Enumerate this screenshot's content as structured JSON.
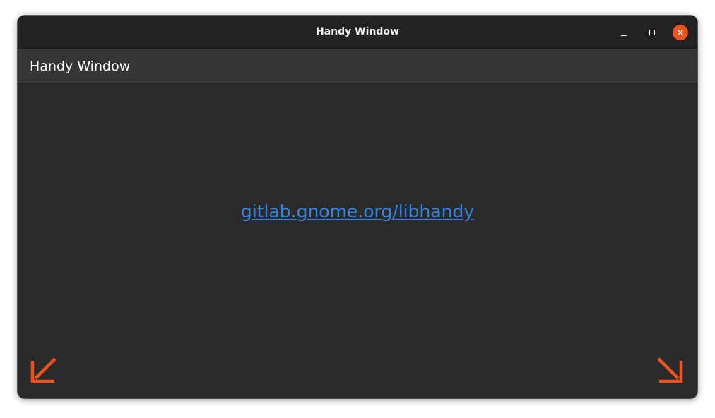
{
  "window": {
    "title": "Handy Window"
  },
  "header": {
    "title": "Handy Window"
  },
  "content": {
    "link_text": "gitlab.gnome.org/libhandy"
  },
  "icons": {
    "minimize": "window-minimize-icon",
    "maximize": "window-maximize-icon",
    "close": "window-close-icon",
    "resize_left": "arrow-down-left-icon",
    "resize_right": "arrow-down-right-icon"
  },
  "colors": {
    "accent": "#e95420",
    "link": "#3584e4",
    "background": "#2a2a2a",
    "headerbar": "#353535",
    "titlebar": "#222222"
  }
}
